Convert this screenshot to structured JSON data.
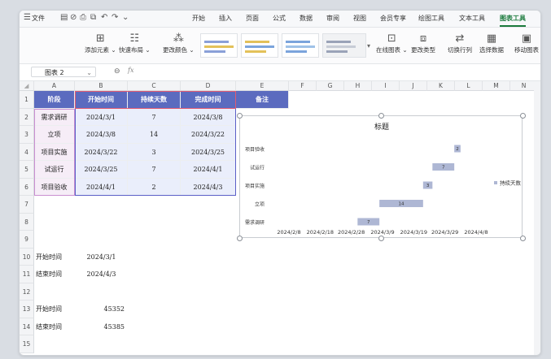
{
  "menu": {
    "file": "文件",
    "tabs": [
      "开始",
      "插入",
      "页面",
      "公式",
      "数据",
      "审阅",
      "视图",
      "会员专享",
      "绘图工具",
      "文本工具",
      "图表工具"
    ],
    "active_tab": "图表工具"
  },
  "ribbon": {
    "add_element": "添加元素",
    "quick_layout": "快速布局",
    "change_color": "更改颜色",
    "online_chart": "在线图表",
    "change_type": "更改类型",
    "switch_rowcol": "切换行列",
    "select_data": "选择数据",
    "move_chart": "移动图表"
  },
  "formula_bar": {
    "name_box": "图表 2",
    "fx": "fx"
  },
  "columns": [
    "A",
    "B",
    "C",
    "D",
    "E",
    "F",
    "G",
    "H",
    "I",
    "J",
    "K",
    "L",
    "M",
    "N"
  ],
  "rows": [
    "1",
    "2",
    "3",
    "4",
    "5",
    "6",
    "7",
    "8",
    "9",
    "10",
    "11",
    "12",
    "13",
    "14",
    "15"
  ],
  "table": {
    "headers": [
      "阶段",
      "开始时间",
      "持续天数",
      "完成时间",
      "备注"
    ],
    "data": [
      [
        "需求调研",
        "2024/3/1",
        "7",
        "2024/3/8"
      ],
      [
        "立项",
        "2024/3/8",
        "14",
        "2024/3/22"
      ],
      [
        "项目实施",
        "2024/3/22",
        "3",
        "2024/3/25"
      ],
      [
        "试运行",
        "2024/3/25",
        "7",
        "2024/4/1"
      ],
      [
        "项目验收",
        "2024/4/1",
        "2",
        "2024/4/3"
      ]
    ]
  },
  "extra": {
    "r10_label": "开始时间",
    "r10_value": "2024/3/1",
    "r11_label": "结束时间",
    "r11_value": "2024/4/3",
    "r13_label": "开始时间",
    "r13_value": "45352",
    "r14_label": "结束时间",
    "r14_value": "45385"
  },
  "colors": {
    "header_fill": "#5b6bbf",
    "row_fill": "#eaeefb",
    "label_fill": "#f6edf7",
    "bar": "#aeb7d4",
    "accent": "#1a7a3c"
  },
  "chart_data": {
    "type": "bar",
    "orientation": "horizontal",
    "stacked": true,
    "title": "标题",
    "categories": [
      "项目验收",
      "试运行",
      "项目实施",
      "立项",
      "需求调研"
    ],
    "offset_start_dates": [
      "2024/4/1",
      "2024/3/25",
      "2024/3/22",
      "2024/3/8",
      "2024/3/1"
    ],
    "series": [
      {
        "name": "持续天数",
        "values": [
          2,
          7,
          3,
          14,
          7
        ]
      }
    ],
    "x_tick_labels": [
      "2024/2/8",
      "2024/2/18",
      "2024/2/28",
      "2024/3/9",
      "2024/3/19",
      "2024/3/29",
      "2024/4/8"
    ],
    "x_axis_start": "2024/2/8",
    "x_axis_end": "2024/4/8",
    "legend": "right",
    "grid": false
  }
}
